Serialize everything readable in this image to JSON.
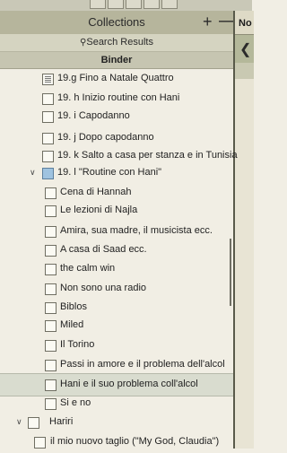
{
  "header": {
    "title": "Collections",
    "plus": "+",
    "minus": "—"
  },
  "right": {
    "no_label": "No",
    "back_icon": "chevron-left"
  },
  "search": {
    "label": "Search Results"
  },
  "binder": {
    "label": "Binder"
  },
  "items": [
    {
      "label": "19.g Fino a Natale  Quattro",
      "type": "doc"
    },
    {
      "label": "19. h Inizio routine con Hani",
      "type": "blank"
    },
    {
      "label": "19. i Capodanno",
      "type": "blank"
    },
    {
      "label": "19. j  Dopo capodanno",
      "type": "blank"
    },
    {
      "label": "19. k Salto a casa per stanza e in Tunisia",
      "type": "blank"
    },
    {
      "label": "19. l \"Routine con Hani\"",
      "type": "folder"
    },
    {
      "label": "Cena di Hannah",
      "type": "blank"
    },
    {
      "label": "Le lezioni di Najla",
      "type": "blank"
    },
    {
      "label": "Amira, sua madre, il musicista ecc.",
      "type": "blank"
    },
    {
      "label": "A casa di Saad ecc.",
      "type": "blank"
    },
    {
      "label": "the calm win",
      "type": "blank"
    },
    {
      "label": "Non sono una radio",
      "type": "blank"
    },
    {
      "label": "Biblos",
      "type": "blank"
    },
    {
      "label": "Miled",
      "type": "blank"
    },
    {
      "label": "Il Torino",
      "type": "blank"
    },
    {
      "label": "Passi in amore e il problema dell'alcol",
      "type": "blank"
    },
    {
      "label": "Hani e il suo problema coll'alcol",
      "type": "blank"
    },
    {
      "label": "Si e no",
      "type": "blank"
    },
    {
      "label": "Hariri",
      "type": "blank"
    },
    {
      "label": "il mio nuovo taglio (\"My God, Claudia\")",
      "type": "blank"
    }
  ],
  "colors": {
    "header_bg": "#b6b59c",
    "selected_bg": "#d9dccf",
    "folder": "#9fc3e0",
    "background": "#f1eee4"
  }
}
